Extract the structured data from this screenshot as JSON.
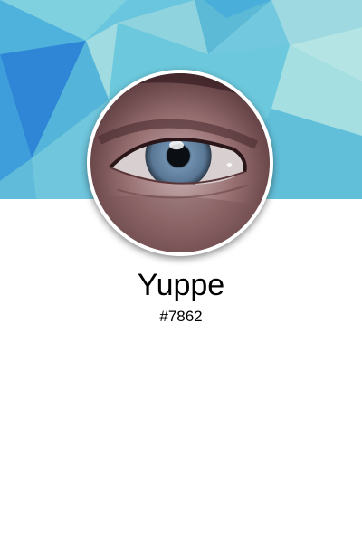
{
  "profile": {
    "username": "Yuppe",
    "discriminator": "#7862"
  },
  "colors": {
    "cover_light": "#a9e2e0",
    "cover_teal": "#59bfd6",
    "cover_blue": "#3a8fdc",
    "iris": "#6b8aa6",
    "skin": "#6b4548"
  },
  "icons": {
    "avatar": "eye-photo"
  }
}
